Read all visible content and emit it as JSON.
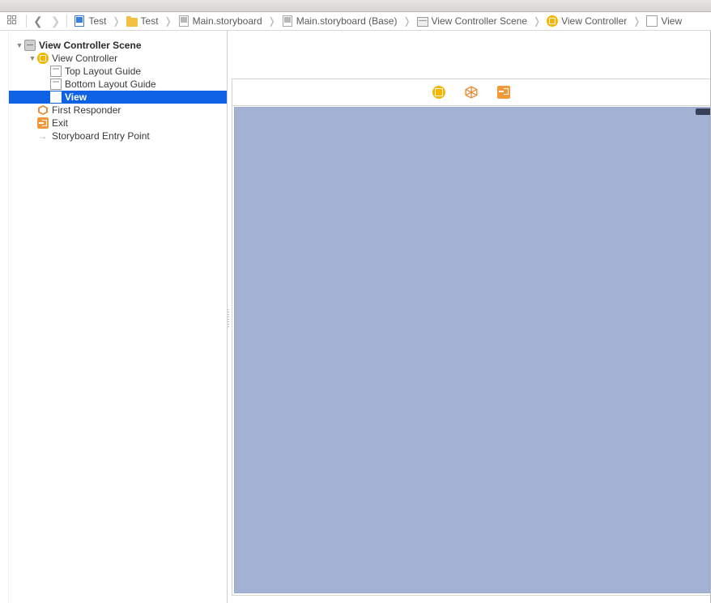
{
  "jumpbar": [
    {
      "icon": "file-blue",
      "label": "Test"
    },
    {
      "icon": "folder",
      "label": "Test"
    },
    {
      "icon": "file-grey",
      "label": "Main.storyboard"
    },
    {
      "icon": "file-grey",
      "label": "Main.storyboard (Base)"
    },
    {
      "icon": "scene-grey",
      "label": "View Controller Scene"
    },
    {
      "icon": "vc",
      "label": "View Controller"
    },
    {
      "icon": "view",
      "label": "View"
    }
  ],
  "outline": {
    "root": {
      "label": "View Controller Scene"
    },
    "vc": {
      "label": "View Controller"
    },
    "top_guide": {
      "label": "Top Layout Guide"
    },
    "bottom_guide": {
      "label": "Bottom Layout Guide"
    },
    "view": {
      "label": "View"
    },
    "first_resp": {
      "label": "First Responder"
    },
    "exit": {
      "label": "Exit"
    },
    "entry": {
      "label": "Storyboard Entry Point"
    }
  },
  "scene_header_icons": [
    "vc",
    "cube",
    "exit"
  ]
}
